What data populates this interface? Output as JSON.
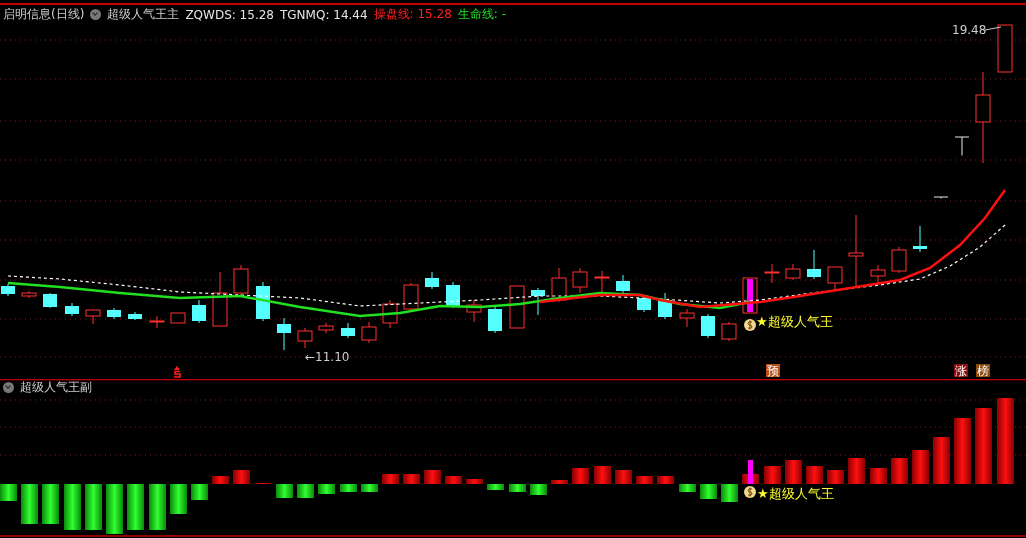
{
  "main_panel": {
    "stock": "启明信息(日线)",
    "indicator": "超级人气王主",
    "readouts": [
      {
        "kind": "plain",
        "label": "ZQWDS: 15.28"
      },
      {
        "kind": "plain",
        "label": "TGNMQ: 14.44"
      },
      {
        "kind": "operate",
        "label": "操盘线: 15.28"
      },
      {
        "kind": "life",
        "label": "生命线: -"
      }
    ],
    "high_label": "19.48",
    "low_label": "←11.10",
    "signal_label": "★超级人气王",
    "markers": [
      {
        "kind": "pre",
        "label": "预"
      },
      {
        "kind": "up",
        "label": "涨"
      },
      {
        "kind": "list",
        "label": "榜"
      }
    ]
  },
  "sub_panel": {
    "indicator": "超级人气王副",
    "signal_label": "★超级人气王"
  }
}
